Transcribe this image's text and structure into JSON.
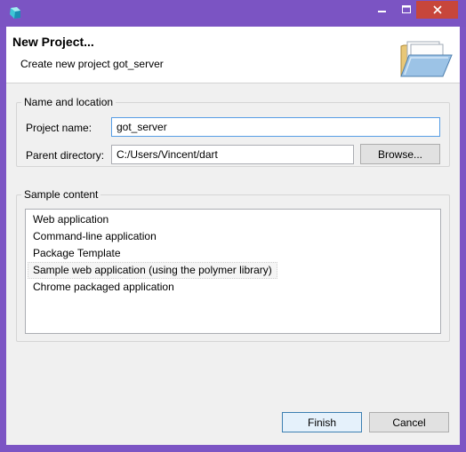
{
  "dialog": {
    "title": "New Project...",
    "description": "Create new project got_server"
  },
  "name_location": {
    "group_label": "Name and location",
    "project_name_label": "Project name:",
    "project_name_value": "got_server",
    "parent_dir_label": "Parent directory:",
    "parent_dir_value": "C:/Users/Vincent/dart",
    "browse_label": "Browse..."
  },
  "sample_content": {
    "group_label": "Sample content",
    "items": [
      {
        "label": "Web application"
      },
      {
        "label": "Command-line application"
      },
      {
        "label": "Package Template"
      },
      {
        "label": "Sample web application (using the polymer library)"
      },
      {
        "label": "Chrome packaged application"
      }
    ]
  },
  "footer": {
    "finish_label": "Finish",
    "cancel_label": "Cancel"
  },
  "colors": {
    "window_frame": "#7b54c3",
    "close_button": "#c7463b",
    "focus_border": "#569de5"
  },
  "icons": {
    "app": "dart-logo-icon",
    "header": "open-folder-icon",
    "minimize": "minimize-icon",
    "maximize": "maximize-icon",
    "close": "close-icon"
  }
}
